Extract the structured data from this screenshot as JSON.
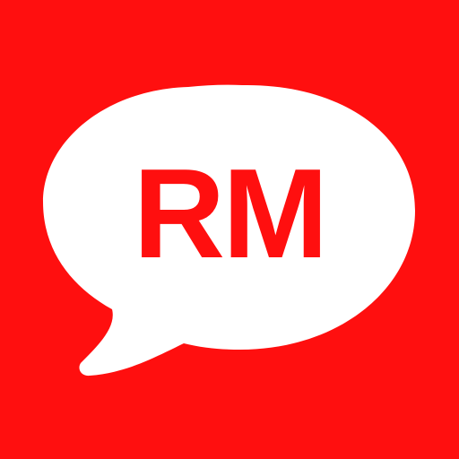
{
  "app_icon": {
    "logo_text": "RM",
    "icon": "speech-bubble-icon",
    "colors": {
      "background": "#ff0f0f",
      "bubble": "#ffffff",
      "text": "#ff0f0f"
    }
  }
}
